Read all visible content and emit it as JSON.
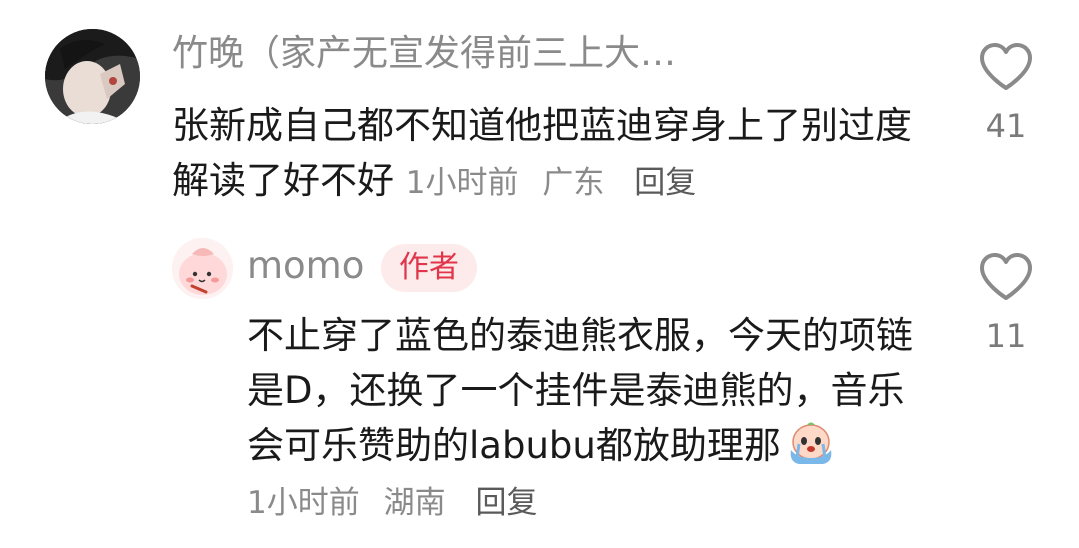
{
  "comment": {
    "username": "竹晚（家产无宣发得前三上大…",
    "body": "张新成自己都不知道他把蓝迪穿身上了别过度解读了好不好",
    "time": "1小时前",
    "location": "广东",
    "reply_label": "回复",
    "likes": "41",
    "avatar_icon": "user-avatar-photo"
  },
  "reply": {
    "username": "momo",
    "badge": "作者",
    "body": "不止穿了蓝色的泰迪熊衣服，今天的项链是D，还换了一个挂件是泰迪熊的，音乐会可乐赞助的labubu都放助理那",
    "emoji": "crying-emoji",
    "time": "1小时前",
    "location": "湖南",
    "reply_label": "回复",
    "likes": "11",
    "avatar_icon": "cartoon-peach-avatar"
  },
  "colors": {
    "text": "#1a1a1a",
    "meta": "#8a8a8a",
    "badge_bg": "#fdeaea",
    "badge_text": "#e0354a"
  }
}
